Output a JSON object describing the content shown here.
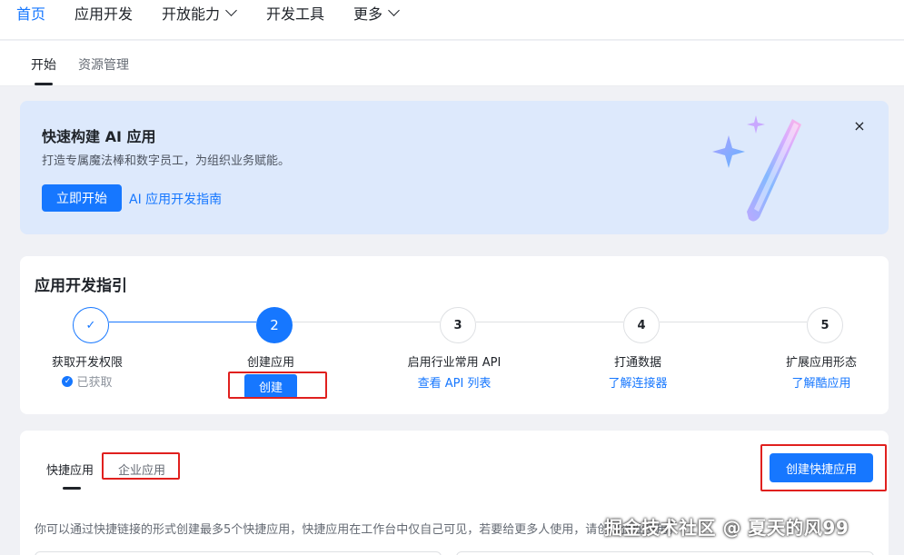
{
  "nav": {
    "home": "首页",
    "app_dev": "应用开发",
    "open_ability": "开放能力",
    "dev_tools": "开发工具",
    "more": "更多"
  },
  "subtabs": {
    "start": "开始",
    "resources": "资源管理"
  },
  "banner": {
    "title": "快速构建 AI 应用",
    "subtitle": "打造专属魔法棒和数字员工，为组织业务赋能。",
    "start_button": "立即开始",
    "guide_link": "AI 应用开发指南",
    "close": "×"
  },
  "guide": {
    "title": "应用开发指引",
    "steps": [
      {
        "number": "✓",
        "label": "获取开发权限",
        "status": "已获取"
      },
      {
        "number": "2",
        "label": "创建应用",
        "action": "创建"
      },
      {
        "number": "3",
        "label": "启用行业常用 API",
        "link": "查看 API 列表"
      },
      {
        "number": "4",
        "label": "打通数据",
        "link": "了解连接器"
      },
      {
        "number": "5",
        "label": "扩展应用形态",
        "link": "了解酷应用"
      }
    ]
  },
  "apps": {
    "tab_fast": "快捷应用",
    "tab_enterprise": "企业应用",
    "create_button": "创建快捷应用",
    "description": "你可以通过快捷链接的形式创建最多5个快捷应用，快捷应用在工作台中仅自己可见，若要给更多人使用，请创建企业应用。"
  },
  "watermark": "掘金技术社区 @ 夏天的风99",
  "colors": {
    "accent": "#1677ff",
    "highlight_box": "#e0201e",
    "banner_bg": "#dde9fc"
  }
}
